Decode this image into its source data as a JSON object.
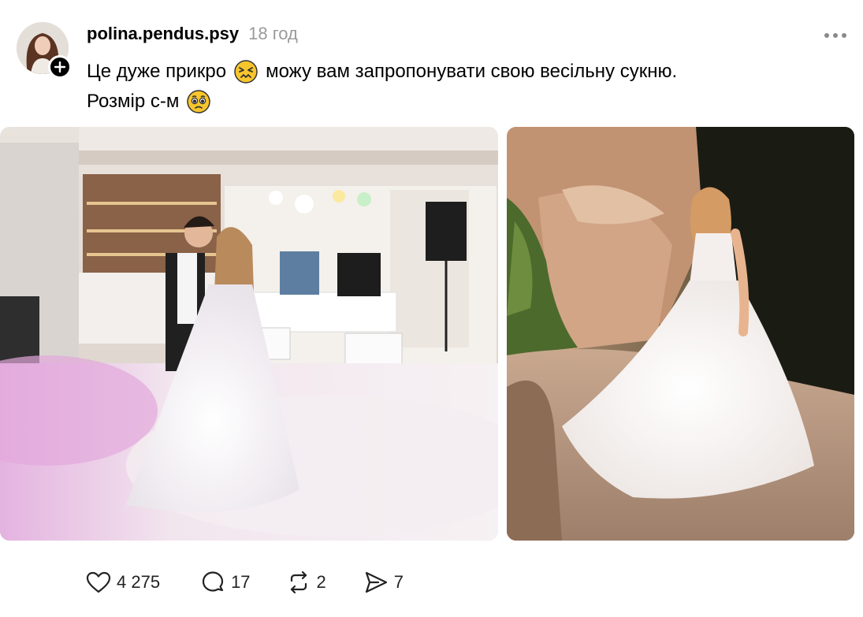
{
  "post": {
    "username": "polina.pendus.psy",
    "timestamp": "18 год",
    "text_line1_a": "Це дуже прикро",
    "text_line1_b": "можу вам запропонувати свою весільну сукню.",
    "text_line2": "Розмір с-м",
    "emoji1": "confounded-face",
    "emoji2": "pleading-face"
  },
  "actions": {
    "likes": "4 275",
    "replies": "17",
    "reposts": "2",
    "shares": "7"
  },
  "icons": {
    "avatar": "avatar",
    "follow": "plus-icon",
    "more": "more-icon",
    "like": "heart-icon",
    "reply": "comment-icon",
    "repost": "repost-icon",
    "share": "send-icon"
  },
  "colors": {
    "text": "#000000",
    "muted": "#9a9a9a",
    "background": "#ffffff"
  }
}
